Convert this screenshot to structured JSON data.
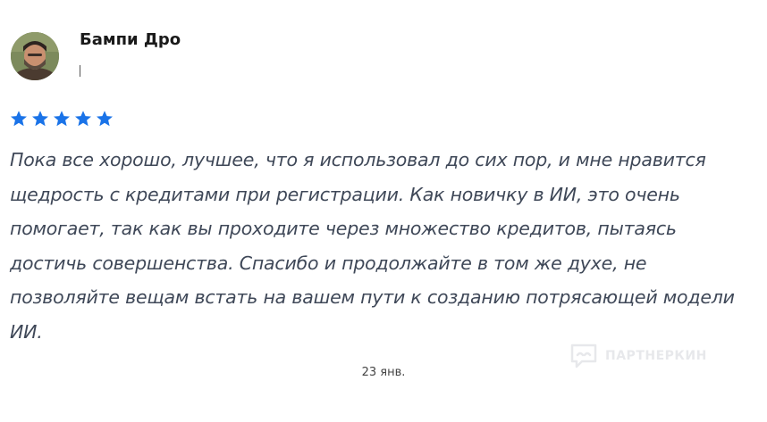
{
  "review": {
    "author_name": "Бампи Дро",
    "author_meta": "",
    "rating": 5,
    "rating_max": 5,
    "star_color": "#1a73e8",
    "text": "Пока все хорошо, лучшее, что я использовал до сих пор, и мне нравится щедрость с кредитами при регистрации. Как новичку в ИИ, это очень помогает, так как вы проходите через множество кредитов, пытаясь достичь совершенства. Спасибо и продолжайте в том же духе, не позволяйте вещам встать на вашем пути к созданию потрясающей модели ИИ.",
    "date": "23 янв."
  },
  "watermark": {
    "text": "ПАРТНЕРКИН",
    "icon": "chat-bubble-logo-icon"
  }
}
